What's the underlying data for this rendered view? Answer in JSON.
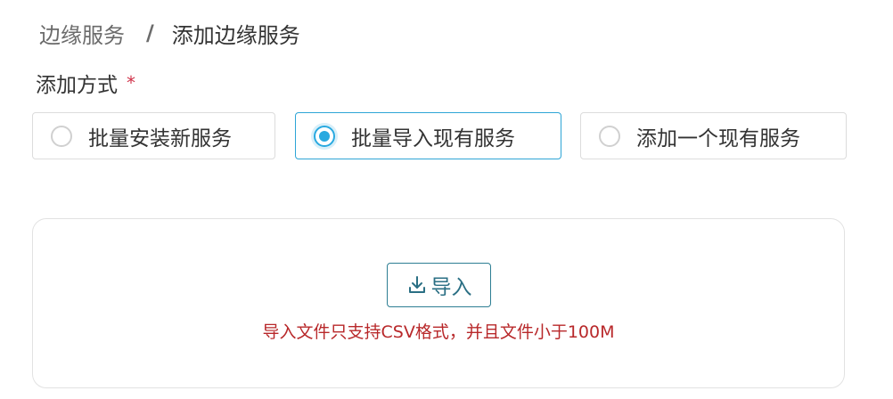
{
  "breadcrumb": {
    "parent": "边缘服务",
    "separator": "/",
    "current": "添加边缘服务"
  },
  "form": {
    "field_label": "添加方式",
    "required_mark": "*",
    "options": [
      {
        "label": "批量安装新服务",
        "selected": false
      },
      {
        "label": "批量导入现有服务",
        "selected": true
      },
      {
        "label": "添加一个现有服务",
        "selected": false
      }
    ]
  },
  "upload": {
    "button_label": "导入",
    "button_icon": "download-icon",
    "hint": "导入文件只支持CSV格式，并且文件小于100M"
  },
  "colors": {
    "accent": "#28a9e0",
    "button_border": "#2d7e93",
    "hint_red": "#b8282a",
    "required_red": "#d0334a"
  }
}
